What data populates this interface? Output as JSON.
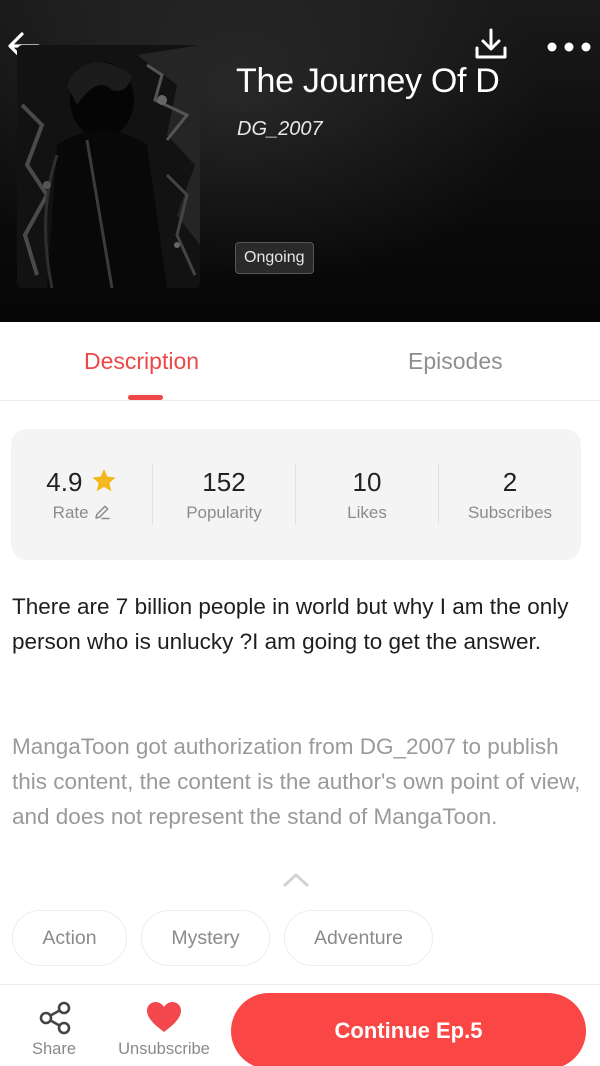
{
  "header": {
    "title": "The Journey Of D",
    "author": "DG_2007",
    "status": "Ongoing",
    "icons": {
      "back": "arrow-left-icon",
      "download": "download-icon",
      "more": "more-dots-icon"
    }
  },
  "tabs": [
    {
      "label": "Description",
      "active": true
    },
    {
      "label": "Episodes",
      "active": false
    }
  ],
  "stats": {
    "rating": {
      "value": "4.9",
      "label": "Rate"
    },
    "popularity": {
      "value": "152",
      "label": "Popularity"
    },
    "likes": {
      "value": "10",
      "label": "Likes"
    },
    "subscribes": {
      "value": "2",
      "label": "Subscribes"
    }
  },
  "description": "There are 7 billion people in world but why I am the only person who is unlucky ?I am going to get the answer.",
  "notice": "MangaToon got authorization from DG_2007 to publish this content, the content is the author's own point of view, and does not represent the stand of MangaToon.",
  "tags": [
    "Action",
    "Mystery",
    "Adventure"
  ],
  "bottom_bar": {
    "share_label": "Share",
    "unsubscribe_label": "Unsubscribe",
    "continue_label": "Continue Ep.5"
  },
  "colors": {
    "accent": "#ee4747",
    "button": "#fb4646",
    "star": "#f5b71e",
    "heart": "#f2474c"
  }
}
